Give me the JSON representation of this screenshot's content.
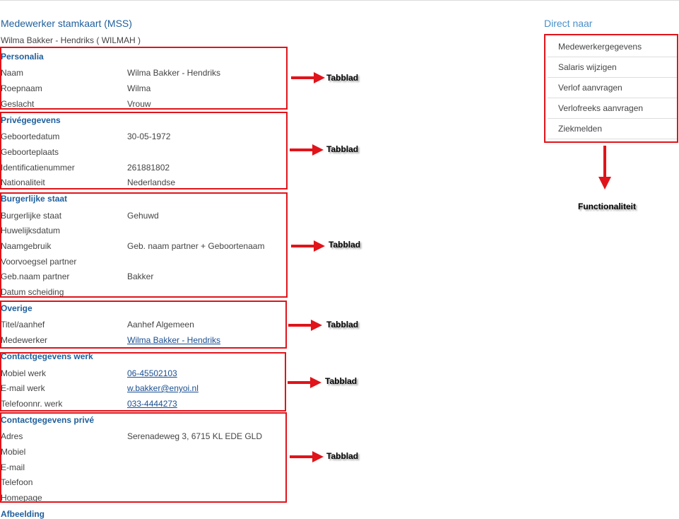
{
  "page_title": "Medewerker stamkaart (MSS)",
  "subtitle": "Wilma Bakker - Hendriks ( WILMAH )",
  "sections": {
    "personalia": {
      "title": "Personalia",
      "rows": [
        {
          "label": "Naam",
          "value": "Wilma Bakker - Hendriks"
        },
        {
          "label": "Roepnaam",
          "value": "Wilma"
        },
        {
          "label": "Geslacht",
          "value": "Vrouw"
        }
      ]
    },
    "prive": {
      "title": "Privégegevens",
      "rows": [
        {
          "label": "Geboortedatum",
          "value": "30-05-1972"
        },
        {
          "label": "Geboorteplaats",
          "value": ""
        },
        {
          "label": "Identificatienummer",
          "value": "261881802"
        },
        {
          "label": "Nationaliteit",
          "value": "Nederlandse"
        }
      ]
    },
    "burgerlijk": {
      "title": "Burgerlijke staat",
      "rows": [
        {
          "label": "Burgerlijke staat",
          "value": "Gehuwd"
        },
        {
          "label": "Huwelijksdatum",
          "value": ""
        },
        {
          "label": "Naamgebruik",
          "value": "Geb. naam partner + Geboortenaam"
        },
        {
          "label": "Voorvoegsel partner",
          "value": ""
        },
        {
          "label": "Geb.naam partner",
          "value": "Bakker"
        },
        {
          "label": "Datum scheiding",
          "value": ""
        }
      ]
    },
    "overige": {
      "title": "Overige",
      "rows": [
        {
          "label": "Titel/aanhef",
          "value": "Aanhef Algemeen"
        },
        {
          "label": "Medewerker",
          "value": "Wilma Bakker - Hendriks"
        }
      ]
    },
    "contact_werk": {
      "title": "Contactgegevens werk",
      "rows": [
        {
          "label": "Mobiel werk",
          "value": "06-45502103"
        },
        {
          "label": "E-mail werk",
          "value": "w.bakker@enyoi.nl"
        },
        {
          "label": "Telefoonnr. werk",
          "value": "033-4444273"
        }
      ]
    },
    "contact_prive": {
      "title": "Contactgegevens privé",
      "rows": [
        {
          "label": "Adres",
          "value": "Serenadeweg 3, 6715 KL  EDE GLD"
        },
        {
          "label": "Mobiel",
          "value": ""
        },
        {
          "label": "E-mail",
          "value": ""
        },
        {
          "label": "Telefoon",
          "value": ""
        },
        {
          "label": "Homepage",
          "value": ""
        }
      ]
    },
    "afbeelding": {
      "title": "Afbeelding"
    }
  },
  "annotations": {
    "tab_label": "Tabblad",
    "functionality_label": "Functionaliteit",
    "color": "#e0141a"
  },
  "direct_naar": {
    "title": "Direct naar",
    "items": [
      {
        "label": "Medewerkergegevens"
      },
      {
        "label": "Salaris wijzigen"
      },
      {
        "label": "Verlof aanvragen"
      },
      {
        "label": "Verlofreeks aanvragen"
      },
      {
        "label": "Ziekmelden"
      }
    ]
  },
  "colors": {
    "heading_blue": "#1f5f9c",
    "link_blue": "#1a4f91",
    "direct_title_blue": "#4a90c8",
    "annotation_red": "#e0141a"
  }
}
